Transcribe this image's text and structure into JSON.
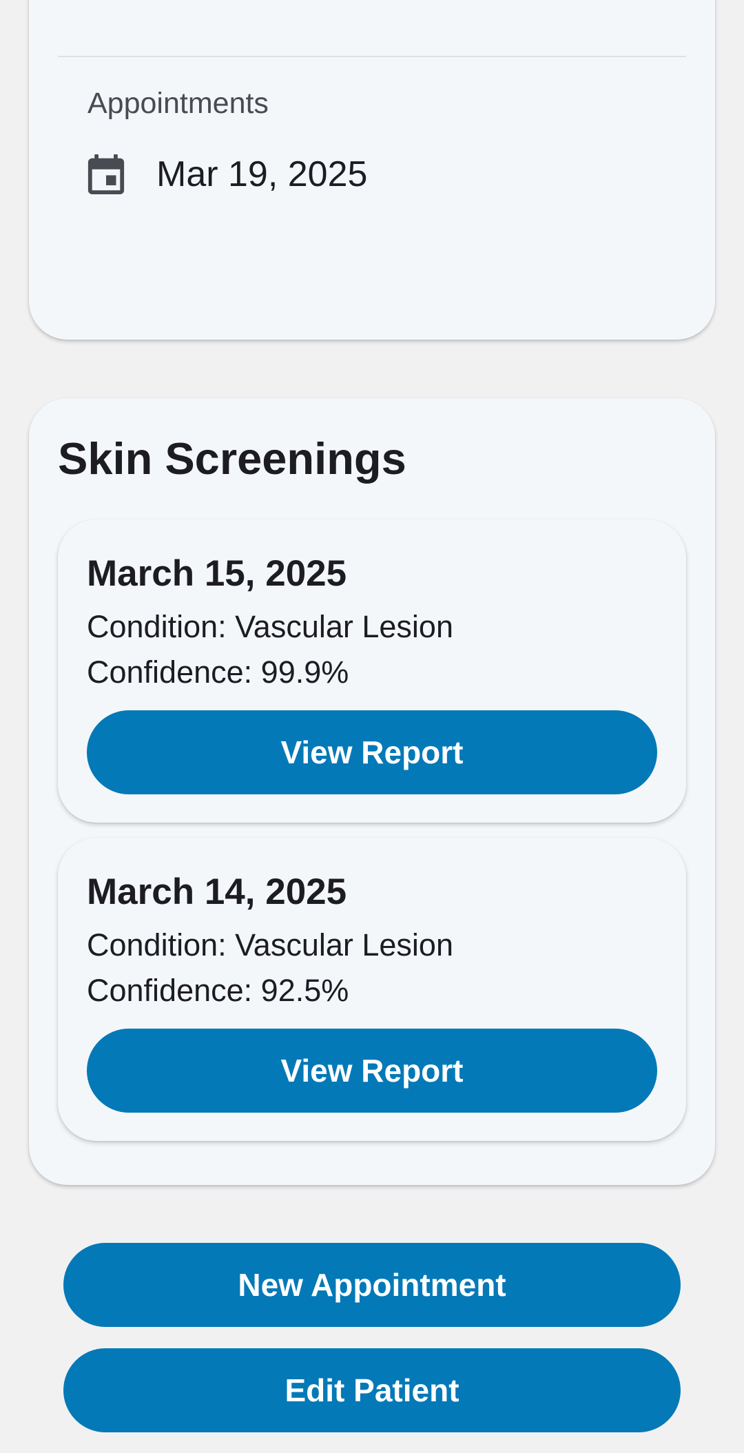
{
  "appointments": {
    "label": "Appointments",
    "date_icon": "calendar-icon",
    "date": "Mar 19, 2025"
  },
  "skin_screenings": {
    "title": "Skin Screenings",
    "items": [
      {
        "date": "March 15, 2025",
        "condition": "Condition: Vascular Lesion",
        "confidence": "Confidence: 99.9%",
        "button_label": "View Report"
      },
      {
        "date": "March 14, 2025",
        "condition": "Condition: Vascular Lesion",
        "confidence": "Confidence: 92.5%",
        "button_label": "View Report"
      }
    ]
  },
  "actions": {
    "new_appointment_label": "New Appointment",
    "edit_patient_label": "Edit Patient"
  },
  "colors": {
    "primary": "#0479b7",
    "card_background": "#f4f7fa",
    "page_background": "#f1f1f2"
  }
}
